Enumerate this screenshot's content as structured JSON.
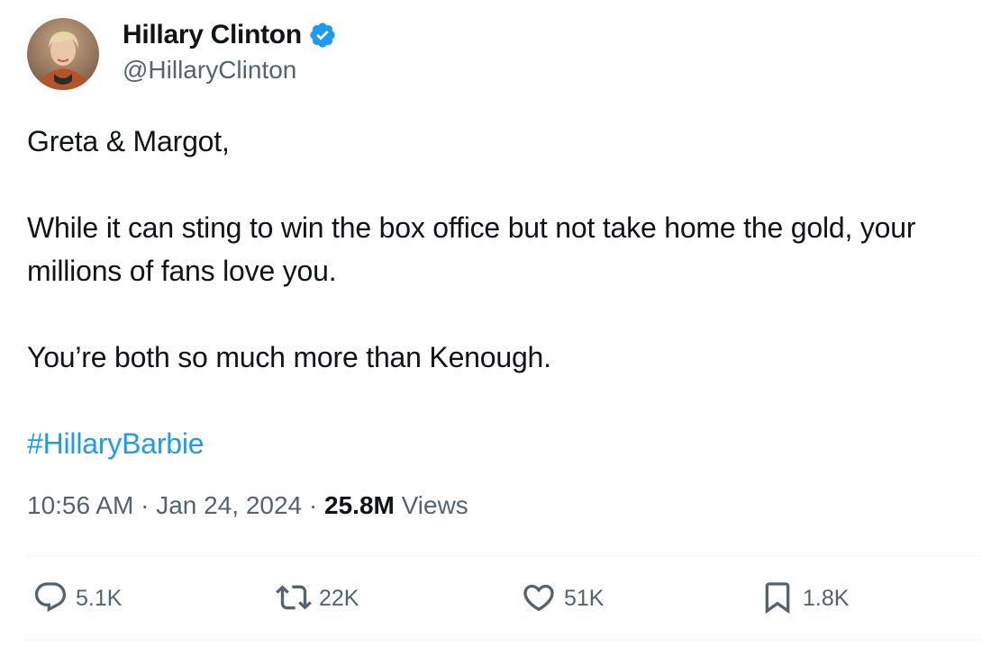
{
  "author": {
    "display_name": "Hillary Clinton",
    "handle": "@HillaryClinton",
    "verified": true
  },
  "tweet": {
    "lines": [
      "Greta & Margot,",
      "While it can sting to win the box office but not take home the gold, your millions of fans love you.",
      "You’re both so much more than Kenough."
    ],
    "hashtag": "#HillaryBarbie",
    "time": "10:56 AM",
    "separator": "·",
    "date": "Jan 24, 2024",
    "views_count": "25.8M",
    "views_label": "Views"
  },
  "actions": {
    "replies": "5.1K",
    "reposts": "22K",
    "likes": "51K",
    "bookmarks": "1.8K"
  },
  "colors": {
    "accent": "#1d9bf0",
    "text": "#0f1419",
    "muted": "#536471",
    "divider": "#eff3f4"
  },
  "icons": [
    "verified-badge-icon",
    "reply-icon",
    "repost-icon",
    "like-icon",
    "bookmark-icon"
  ]
}
